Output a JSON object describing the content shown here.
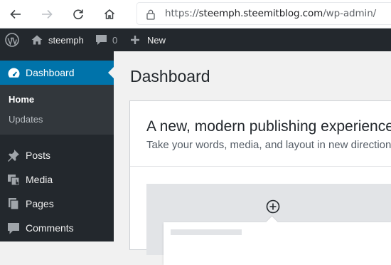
{
  "browser": {
    "url_prefix": "https://",
    "url_host": "steemph.steemitblog.com",
    "url_path": "/wp-admin/"
  },
  "adminbar": {
    "site_name": "steemph",
    "comments_count": "0",
    "new_label": "New"
  },
  "sidebar": {
    "current": "Dashboard",
    "submenu": [
      "Home",
      "Updates"
    ],
    "items": [
      {
        "label": "Posts",
        "icon": "pushpin-icon"
      },
      {
        "label": "Media",
        "icon": "media-icon"
      },
      {
        "label": "Pages",
        "icon": "pages-icon"
      },
      {
        "label": "Comments",
        "icon": "comments-icon"
      }
    ]
  },
  "main": {
    "title": "Dashboard",
    "panel_heading": "A new, modern publishing experience",
    "panel_sub": "Take your words, media, and layout in new directions"
  },
  "colors": {
    "admin_bar": "#23282d",
    "accent": "#0073aa",
    "submenu_bg": "#32373c",
    "page_bg": "#f1f1f1"
  }
}
